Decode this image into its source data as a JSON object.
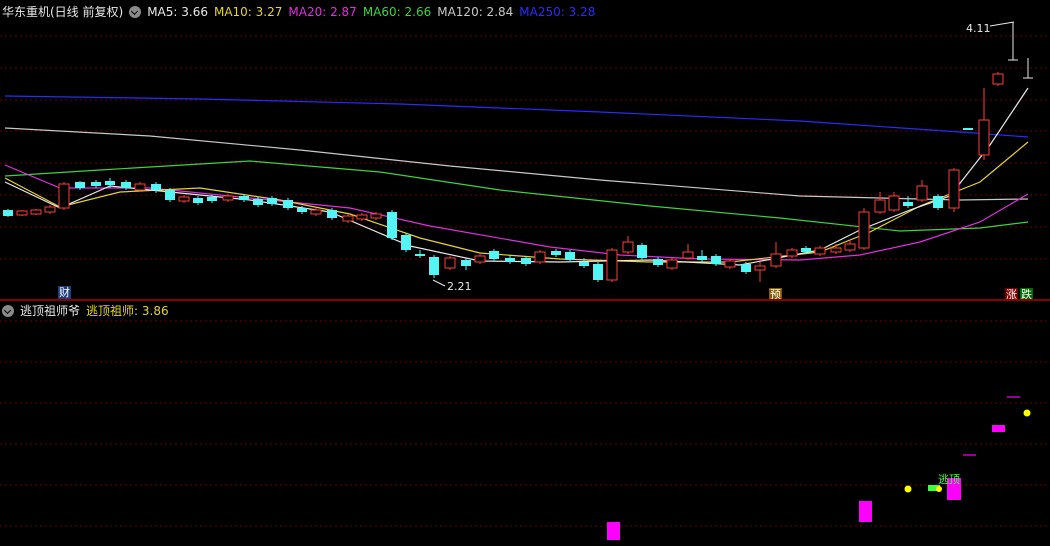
{
  "main": {
    "title": "华东重机(日线 前复权)",
    "ma": [
      {
        "label": "MA5: 3.66",
        "color": "#e8e8e8"
      },
      {
        "label": "MA10: 3.27",
        "color": "#e6d23a"
      },
      {
        "label": "MA20: 2.87",
        "color": "#e02ee0"
      },
      {
        "label": "MA60: 2.66",
        "color": "#3fd23f"
      },
      {
        "label": "MA120: 2.84",
        "color": "#c8c8c8"
      },
      {
        "label": "MA250: 3.28",
        "color": "#2a2aff"
      }
    ],
    "high_label": "4.11",
    "low_label": "2.21",
    "markers": {
      "cai": "财",
      "yu": "预",
      "zhang": "涨",
      "die": "跌"
    },
    "colors": {
      "up": "#ff3b3b",
      "down": "#54f5f5",
      "grid": "#6b0000"
    }
  },
  "indicator": {
    "title": "逃顶祖师爷",
    "value_label": "逃顶祖师: 3.86",
    "signal_text": "逃顶",
    "colors": {
      "bar": "#ff00ff",
      "dot": "#ffff00",
      "signal": "#3cff3c"
    }
  }
}
